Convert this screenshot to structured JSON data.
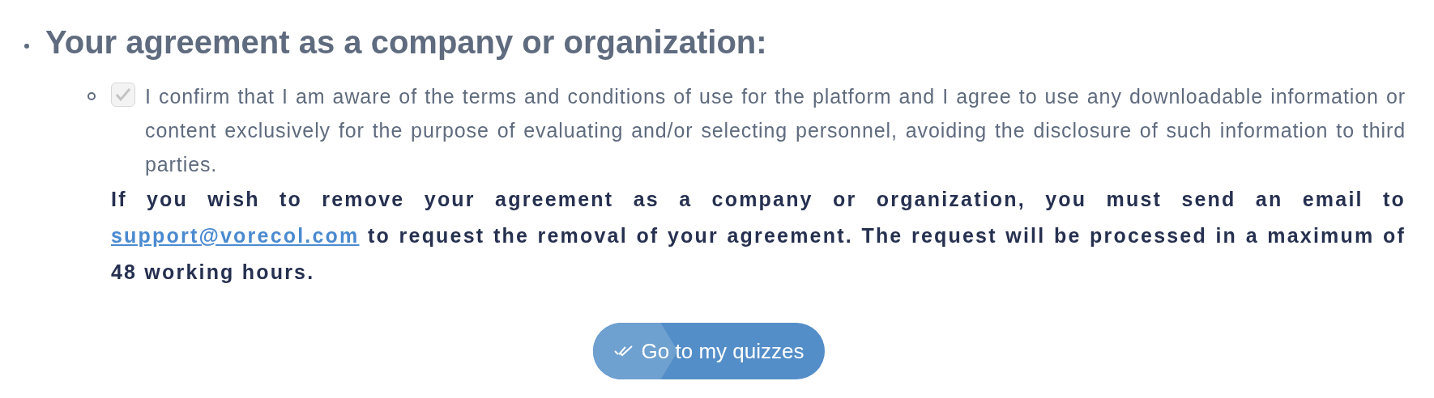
{
  "heading": "Your agreement as a company or organization:",
  "agreement": {
    "checked": true,
    "text": "I confirm that I am aware of the terms and conditions of use for the platform and I agree to use any downloadable information or content exclusively for the purpose of evaluating and/or selecting personnel, avoiding the disclosure of such information to third parties."
  },
  "notice": {
    "before": "If you wish to remove your agreement as a company or organization, you must send an email to",
    "email": "support@vorecol.com",
    "after": "to request the removal of your agreement. The request will be processed in a maximum of 48 working hours."
  },
  "button": {
    "label": "Go to my quizzes"
  }
}
